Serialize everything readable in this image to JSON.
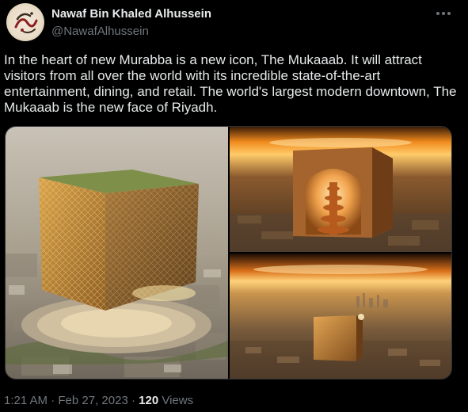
{
  "author": {
    "display_name": "Nawaf Bin Khaled Alhussein",
    "handle": "@NawafAlhussein",
    "avatar_icon": "calligraphy-logo"
  },
  "more_icon": "ellipsis-icon",
  "tweet": {
    "text": "In the heart of new Murabba is a new icon, The Mukaaab. It will attract visitors from all over the world with its incredible state-of-the-art entertainment, dining, and retail. The world's largest modern downtown, The Mukaaab is the new face of Riyadh."
  },
  "media": [
    {
      "subject": "mukaaab-aerial-city-view"
    },
    {
      "subject": "mukaaab-interior-dome-view"
    },
    {
      "subject": "mukaaab-sunset-skyline-view"
    }
  ],
  "meta": {
    "time": "1:21 AM",
    "separator": "·",
    "date": "Feb 27, 2023",
    "views_count": "120",
    "views_label": "Views"
  },
  "colors": {
    "background": "#000000",
    "text_primary": "#e7e9ea",
    "text_secondary": "#71767b",
    "border": "#2f3336"
  }
}
